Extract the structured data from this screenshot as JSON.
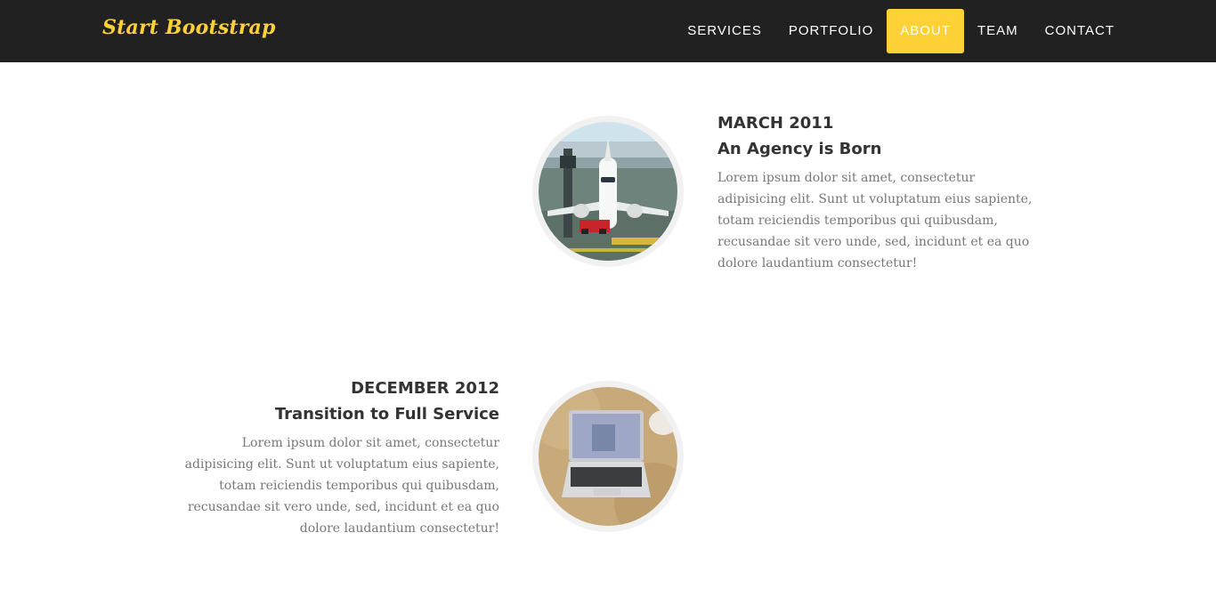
{
  "navbar": {
    "brand": "Start Bootstrap",
    "links": [
      {
        "label": "SERVICES",
        "active": false
      },
      {
        "label": "PORTFOLIO",
        "active": false
      },
      {
        "label": "ABOUT",
        "active": true
      },
      {
        "label": "TEAM",
        "active": false
      },
      {
        "label": "CONTACT",
        "active": false
      }
    ]
  },
  "timeline": [
    {
      "date": "MARCH 2011",
      "heading": "An Agency is Born",
      "body": "Lorem ipsum dolor sit amet, consectetur adipisicing elit. Sunt ut voluptatum eius sapiente, totam reiciendis temporibus qui quibusdam, recusandae sit vero unde, sed, incidunt et ea quo dolore laudantium consectetur!",
      "image": "airplane-photo"
    },
    {
      "date": "DECEMBER 2012",
      "heading": "Transition to Full Service",
      "body": "Lorem ipsum dolor sit amet, consectetur adipisicing elit. Sunt ut voluptatum eius sapiente, totam reiciendis temporibus qui quibusdam, recusandae sit vero unde, sed, incidunt et ea quo dolore laudantium consectetur!",
      "image": "laptop-photo"
    }
  ],
  "colors": {
    "navbar_bg": "#212121",
    "accent": "#fed136",
    "heading": "#333333",
    "muted_text": "#777777",
    "image_ring": "#f1f1f1"
  }
}
